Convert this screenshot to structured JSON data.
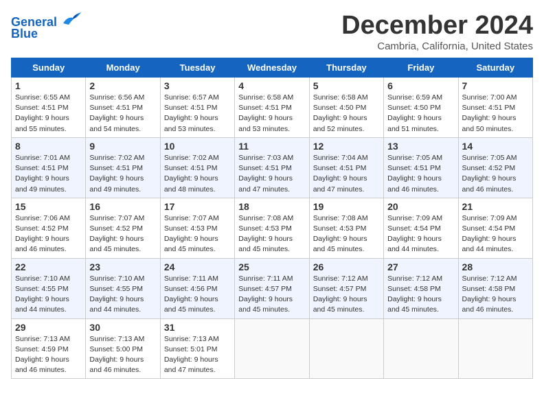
{
  "logo": {
    "line1": "General",
    "line2": "Blue"
  },
  "title": "December 2024",
  "location": "Cambria, California, United States",
  "days_of_week": [
    "Sunday",
    "Monday",
    "Tuesday",
    "Wednesday",
    "Thursday",
    "Friday",
    "Saturday"
  ],
  "weeks": [
    [
      {
        "day": "1",
        "sunrise": "6:55 AM",
        "sunset": "4:51 PM",
        "daylight": "9 hours and 55 minutes."
      },
      {
        "day": "2",
        "sunrise": "6:56 AM",
        "sunset": "4:51 PM",
        "daylight": "9 hours and 54 minutes."
      },
      {
        "day": "3",
        "sunrise": "6:57 AM",
        "sunset": "4:51 PM",
        "daylight": "9 hours and 53 minutes."
      },
      {
        "day": "4",
        "sunrise": "6:58 AM",
        "sunset": "4:51 PM",
        "daylight": "9 hours and 53 minutes."
      },
      {
        "day": "5",
        "sunrise": "6:58 AM",
        "sunset": "4:50 PM",
        "daylight": "9 hours and 52 minutes."
      },
      {
        "day": "6",
        "sunrise": "6:59 AM",
        "sunset": "4:50 PM",
        "daylight": "9 hours and 51 minutes."
      },
      {
        "day": "7",
        "sunrise": "7:00 AM",
        "sunset": "4:51 PM",
        "daylight": "9 hours and 50 minutes."
      }
    ],
    [
      {
        "day": "8",
        "sunrise": "7:01 AM",
        "sunset": "4:51 PM",
        "daylight": "9 hours and 49 minutes."
      },
      {
        "day": "9",
        "sunrise": "7:02 AM",
        "sunset": "4:51 PM",
        "daylight": "9 hours and 49 minutes."
      },
      {
        "day": "10",
        "sunrise": "7:02 AM",
        "sunset": "4:51 PM",
        "daylight": "9 hours and 48 minutes."
      },
      {
        "day": "11",
        "sunrise": "7:03 AM",
        "sunset": "4:51 PM",
        "daylight": "9 hours and 47 minutes."
      },
      {
        "day": "12",
        "sunrise": "7:04 AM",
        "sunset": "4:51 PM",
        "daylight": "9 hours and 47 minutes."
      },
      {
        "day": "13",
        "sunrise": "7:05 AM",
        "sunset": "4:51 PM",
        "daylight": "9 hours and 46 minutes."
      },
      {
        "day": "14",
        "sunrise": "7:05 AM",
        "sunset": "4:52 PM",
        "daylight": "9 hours and 46 minutes."
      }
    ],
    [
      {
        "day": "15",
        "sunrise": "7:06 AM",
        "sunset": "4:52 PM",
        "daylight": "9 hours and 46 minutes."
      },
      {
        "day": "16",
        "sunrise": "7:07 AM",
        "sunset": "4:52 PM",
        "daylight": "9 hours and 45 minutes."
      },
      {
        "day": "17",
        "sunrise": "7:07 AM",
        "sunset": "4:53 PM",
        "daylight": "9 hours and 45 minutes."
      },
      {
        "day": "18",
        "sunrise": "7:08 AM",
        "sunset": "4:53 PM",
        "daylight": "9 hours and 45 minutes."
      },
      {
        "day": "19",
        "sunrise": "7:08 AM",
        "sunset": "4:53 PM",
        "daylight": "9 hours and 45 minutes."
      },
      {
        "day": "20",
        "sunrise": "7:09 AM",
        "sunset": "4:54 PM",
        "daylight": "9 hours and 44 minutes."
      },
      {
        "day": "21",
        "sunrise": "7:09 AM",
        "sunset": "4:54 PM",
        "daylight": "9 hours and 44 minutes."
      }
    ],
    [
      {
        "day": "22",
        "sunrise": "7:10 AM",
        "sunset": "4:55 PM",
        "daylight": "9 hours and 44 minutes."
      },
      {
        "day": "23",
        "sunrise": "7:10 AM",
        "sunset": "4:55 PM",
        "daylight": "9 hours and 44 minutes."
      },
      {
        "day": "24",
        "sunrise": "7:11 AM",
        "sunset": "4:56 PM",
        "daylight": "9 hours and 45 minutes."
      },
      {
        "day": "25",
        "sunrise": "7:11 AM",
        "sunset": "4:57 PM",
        "daylight": "9 hours and 45 minutes."
      },
      {
        "day": "26",
        "sunrise": "7:12 AM",
        "sunset": "4:57 PM",
        "daylight": "9 hours and 45 minutes."
      },
      {
        "day": "27",
        "sunrise": "7:12 AM",
        "sunset": "4:58 PM",
        "daylight": "9 hours and 45 minutes."
      },
      {
        "day": "28",
        "sunrise": "7:12 AM",
        "sunset": "4:58 PM",
        "daylight": "9 hours and 46 minutes."
      }
    ],
    [
      {
        "day": "29",
        "sunrise": "7:13 AM",
        "sunset": "4:59 PM",
        "daylight": "9 hours and 46 minutes."
      },
      {
        "day": "30",
        "sunrise": "7:13 AM",
        "sunset": "5:00 PM",
        "daylight": "9 hours and 46 minutes."
      },
      {
        "day": "31",
        "sunrise": "7:13 AM",
        "sunset": "5:01 PM",
        "daylight": "9 hours and 47 minutes."
      },
      null,
      null,
      null,
      null
    ]
  ]
}
